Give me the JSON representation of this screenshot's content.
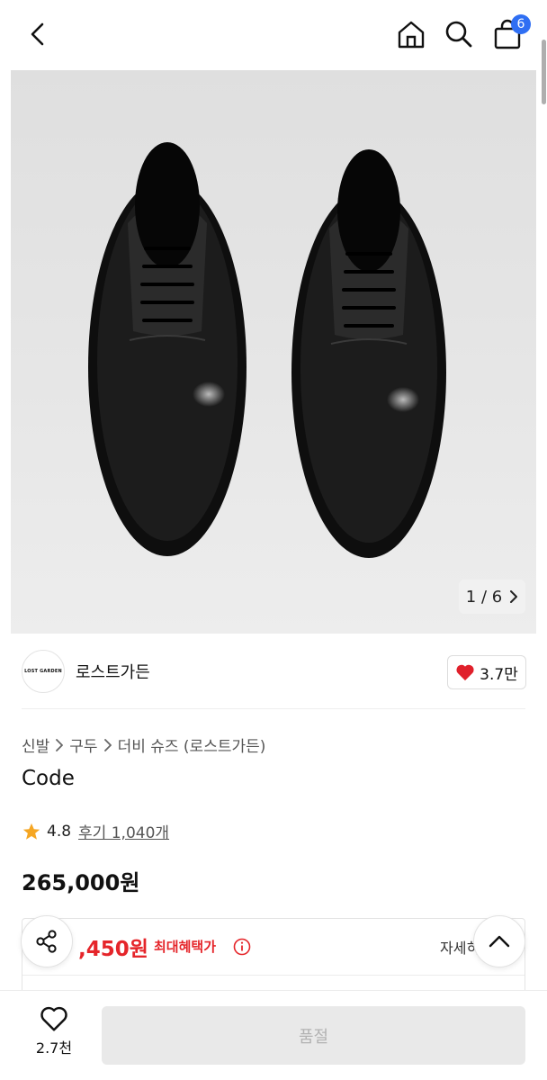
{
  "header": {
    "cart_count": "6",
    "icons": [
      "chevron-left-icon",
      "home-icon",
      "search-icon",
      "shopping-bag-icon"
    ]
  },
  "gallery": {
    "counter": "1 / 6"
  },
  "brand": {
    "logo_text": "LOST GARDEN",
    "name": "로스트가든",
    "likes": "3.7만"
  },
  "breadcrumb": {
    "items": [
      "신발",
      "구두",
      "더비 슈즈 (로스트가든)"
    ]
  },
  "product": {
    "title": "Code",
    "rating": "4.8",
    "reviews": "후기 1,040개",
    "price": "265,000원"
  },
  "benefit": {
    "max_price": ",450원",
    "max_label": "최대혜택가",
    "detail_link": "자세히"
  },
  "bottom": {
    "wish_count": "2.7천",
    "buy_label": "품절"
  },
  "colors": {
    "accent_red": "#e5252a",
    "badge_blue": "#2f6ff3",
    "star": "#f5a623"
  }
}
